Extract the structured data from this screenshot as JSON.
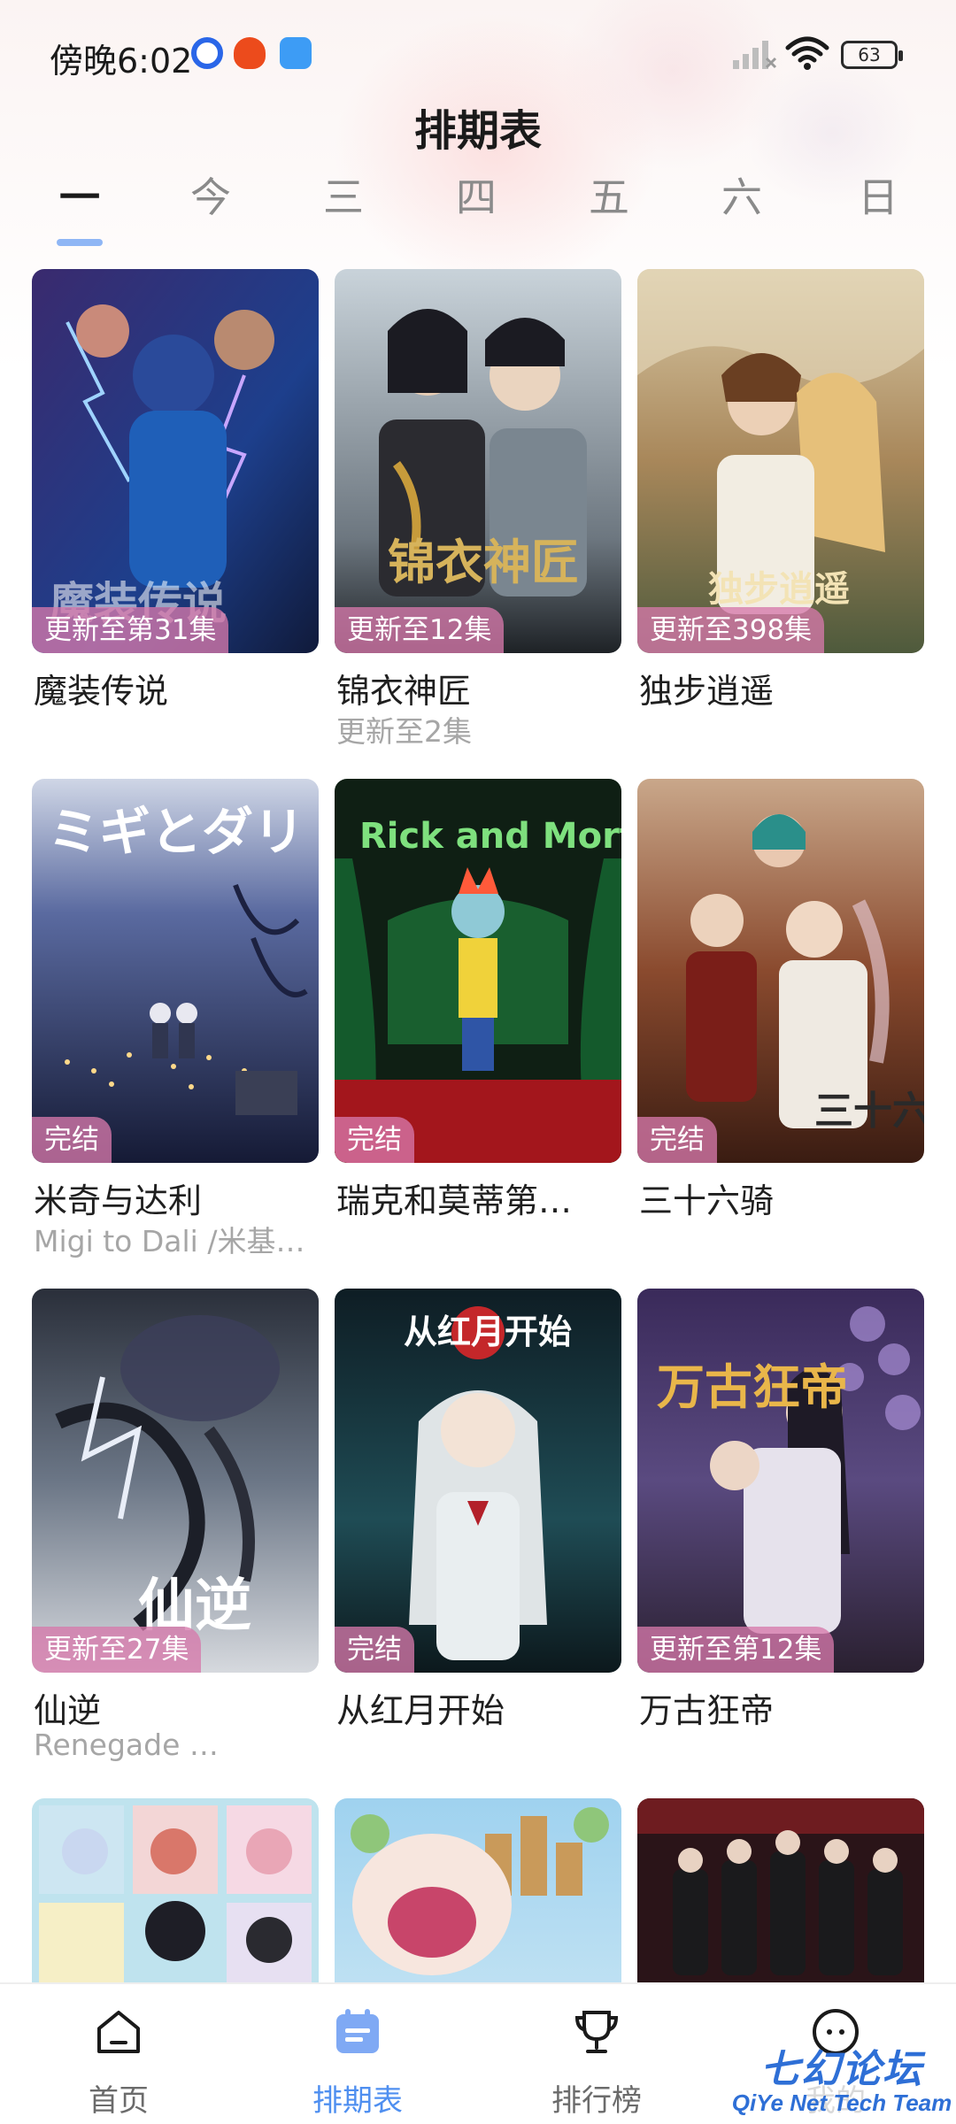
{
  "status_bar": {
    "time": "傍晚6:02",
    "battery": "63",
    "icons": [
      "location-ring-icon",
      "red-app-icon",
      "blue-app-icon",
      "signal-icon",
      "wifi-icon",
      "battery-icon"
    ]
  },
  "page_title": "排期表",
  "day_tabs": {
    "active_index": 0,
    "labels": [
      "一",
      "今",
      "三",
      "四",
      "五",
      "六",
      "日"
    ]
  },
  "cards": [
    {
      "title": "魔装传说",
      "badge": "更新至第31集",
      "subtitle": ""
    },
    {
      "title": "锦衣神匠",
      "badge": "更新至12集",
      "subtitle": "更新至2集"
    },
    {
      "title": "独步逍遥",
      "badge": "更新至398集",
      "subtitle": ""
    },
    {
      "title": "米奇与达利",
      "badge": "完结",
      "subtitle": "Migi to Dali /米基…"
    },
    {
      "title": "瑞克和莫蒂第…",
      "badge": "完结",
      "subtitle": ""
    },
    {
      "title": "三十六骑",
      "badge": "完结",
      "subtitle": ""
    },
    {
      "title": "仙逆",
      "badge": "更新至27集",
      "subtitle": "Renegade …"
    },
    {
      "title": "从红月开始",
      "badge": "完结",
      "subtitle": ""
    },
    {
      "title": "万古狂帝",
      "badge": "更新至第12集",
      "subtitle": ""
    },
    {
      "title": "",
      "badge": "",
      "subtitle": ""
    },
    {
      "title": "",
      "badge": "",
      "subtitle": ""
    },
    {
      "title": "",
      "badge": "",
      "subtitle": ""
    }
  ],
  "poster_texts": {
    "p1": "魔装传说",
    "p2": "锦衣神匠",
    "p3": "独步逍遥",
    "p4": "ミギとダリ",
    "p5": "Rick and Morty",
    "p6": "三十六骑",
    "p7": "仙逆",
    "p8": "从红月开始",
    "p9": "万古狂帝"
  },
  "bottom_nav": [
    {
      "label": "首页",
      "icon": "home-icon"
    },
    {
      "label": "排期表",
      "icon": "schedule-icon"
    },
    {
      "label": "排行榜",
      "icon": "trophy-icon"
    },
    {
      "label": "我的",
      "icon": "profile-icon"
    }
  ],
  "watermark": {
    "cn": "七幻论坛",
    "en": "QiYe Net Tech Team"
  },
  "colors": {
    "accent": "#4f8ff0",
    "badge": "#d678aa",
    "tab_indicator": "#8fb6f5"
  }
}
